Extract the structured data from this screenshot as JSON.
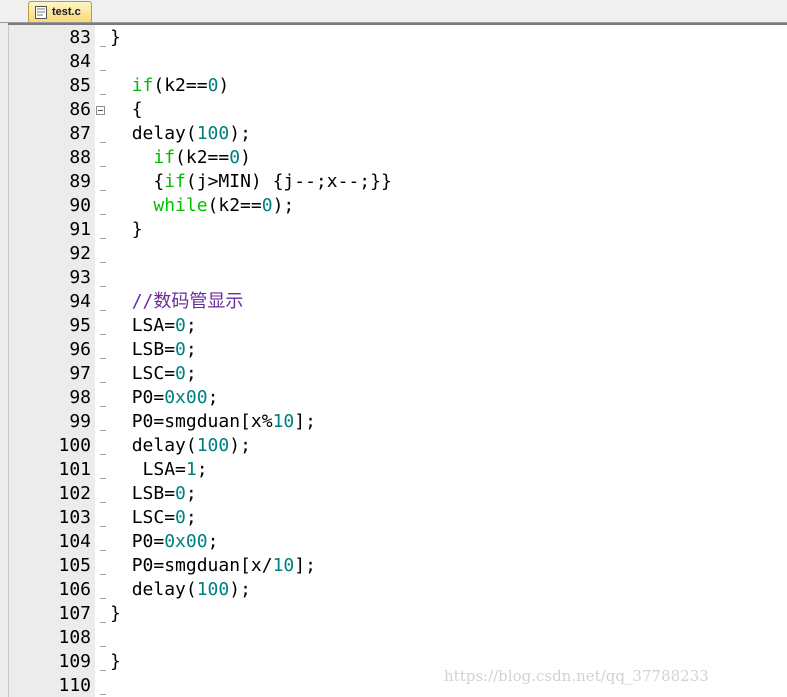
{
  "tab": {
    "filename": "test.c",
    "icon": "c-file-icon"
  },
  "watermark": "https://blog.csdn.net/qq_37788233",
  "colors": {
    "keyword": "#00c000",
    "number": "#008080",
    "comment": "#6a2d9c",
    "text": "#000000"
  },
  "lines": [
    {
      "n": "83",
      "indent": "",
      "tokens": [
        {
          "t": "}",
          "c": ""
        }
      ]
    },
    {
      "n": "84",
      "indent": "",
      "tokens": []
    },
    {
      "n": "85",
      "indent": "  ",
      "tokens": [
        {
          "t": "if",
          "c": "kw"
        },
        {
          "t": "(k2==",
          "c": ""
        },
        {
          "t": "0",
          "c": "num"
        },
        {
          "t": ")",
          "c": ""
        }
      ]
    },
    {
      "n": "86",
      "indent": "  ",
      "tokens": [
        {
          "t": "{",
          "c": ""
        }
      ],
      "fold": true
    },
    {
      "n": "87",
      "indent": "  ",
      "tokens": [
        {
          "t": "delay(",
          "c": ""
        },
        {
          "t": "100",
          "c": "num"
        },
        {
          "t": ");",
          "c": ""
        }
      ]
    },
    {
      "n": "88",
      "indent": "    ",
      "tokens": [
        {
          "t": "if",
          "c": "kw"
        },
        {
          "t": "(k2==",
          "c": ""
        },
        {
          "t": "0",
          "c": "num"
        },
        {
          "t": ")",
          "c": ""
        }
      ]
    },
    {
      "n": "89",
      "indent": "    ",
      "tokens": [
        {
          "t": "{",
          "c": ""
        },
        {
          "t": "if",
          "c": "kw"
        },
        {
          "t": "(j>MIN) {j--;x--;}}",
          "c": ""
        }
      ]
    },
    {
      "n": "90",
      "indent": "    ",
      "tokens": [
        {
          "t": "while",
          "c": "kw"
        },
        {
          "t": "(k2==",
          "c": ""
        },
        {
          "t": "0",
          "c": "num"
        },
        {
          "t": ");",
          "c": ""
        }
      ]
    },
    {
      "n": "91",
      "indent": "  ",
      "tokens": [
        {
          "t": "}",
          "c": ""
        }
      ]
    },
    {
      "n": "92",
      "indent": "",
      "tokens": []
    },
    {
      "n": "93",
      "indent": "",
      "tokens": []
    },
    {
      "n": "94",
      "indent": "  ",
      "tokens": [
        {
          "t": "//数码管显示",
          "c": "cmt"
        }
      ]
    },
    {
      "n": "95",
      "indent": "  ",
      "tokens": [
        {
          "t": "LSA=",
          "c": ""
        },
        {
          "t": "0",
          "c": "num"
        },
        {
          "t": ";",
          "c": ""
        }
      ]
    },
    {
      "n": "96",
      "indent": "  ",
      "tokens": [
        {
          "t": "LSB=",
          "c": ""
        },
        {
          "t": "0",
          "c": "num"
        },
        {
          "t": ";",
          "c": ""
        }
      ]
    },
    {
      "n": "97",
      "indent": "  ",
      "tokens": [
        {
          "t": "LSC=",
          "c": ""
        },
        {
          "t": "0",
          "c": "num"
        },
        {
          "t": ";",
          "c": ""
        }
      ]
    },
    {
      "n": "98",
      "indent": "  ",
      "tokens": [
        {
          "t": "P0=",
          "c": ""
        },
        {
          "t": "0x00",
          "c": "num"
        },
        {
          "t": ";",
          "c": ""
        }
      ]
    },
    {
      "n": "99",
      "indent": "  ",
      "tokens": [
        {
          "t": "P0=smgduan[x%",
          "c": ""
        },
        {
          "t": "10",
          "c": "num"
        },
        {
          "t": "];",
          "c": ""
        }
      ]
    },
    {
      "n": "100",
      "indent": "  ",
      "tokens": [
        {
          "t": "delay(",
          "c": ""
        },
        {
          "t": "100",
          "c": "num"
        },
        {
          "t": ");",
          "c": ""
        }
      ]
    },
    {
      "n": "101",
      "indent": "   ",
      "tokens": [
        {
          "t": "LSA=",
          "c": ""
        },
        {
          "t": "1",
          "c": "num"
        },
        {
          "t": ";",
          "c": ""
        }
      ]
    },
    {
      "n": "102",
      "indent": "  ",
      "tokens": [
        {
          "t": "LSB=",
          "c": ""
        },
        {
          "t": "0",
          "c": "num"
        },
        {
          "t": ";",
          "c": ""
        }
      ]
    },
    {
      "n": "103",
      "indent": "  ",
      "tokens": [
        {
          "t": "LSC=",
          "c": ""
        },
        {
          "t": "0",
          "c": "num"
        },
        {
          "t": ";",
          "c": ""
        }
      ]
    },
    {
      "n": "104",
      "indent": "  ",
      "tokens": [
        {
          "t": "P0=",
          "c": ""
        },
        {
          "t": "0x00",
          "c": "num"
        },
        {
          "t": ";",
          "c": ""
        }
      ]
    },
    {
      "n": "105",
      "indent": "  ",
      "tokens": [
        {
          "t": "P0=smgduan[x/",
          "c": ""
        },
        {
          "t": "10",
          "c": "num"
        },
        {
          "t": "];",
          "c": ""
        }
      ]
    },
    {
      "n": "106",
      "indent": "  ",
      "tokens": [
        {
          "t": "delay(",
          "c": ""
        },
        {
          "t": "100",
          "c": "num"
        },
        {
          "t": ");",
          "c": ""
        }
      ]
    },
    {
      "n": "107",
      "indent": "",
      "tokens": [
        {
          "t": "}",
          "c": ""
        }
      ]
    },
    {
      "n": "108",
      "indent": "",
      "tokens": []
    },
    {
      "n": "109",
      "indent": "",
      "tokens": [
        {
          "t": "}",
          "c": ""
        }
      ]
    },
    {
      "n": "110",
      "indent": "",
      "tokens": []
    }
  ]
}
